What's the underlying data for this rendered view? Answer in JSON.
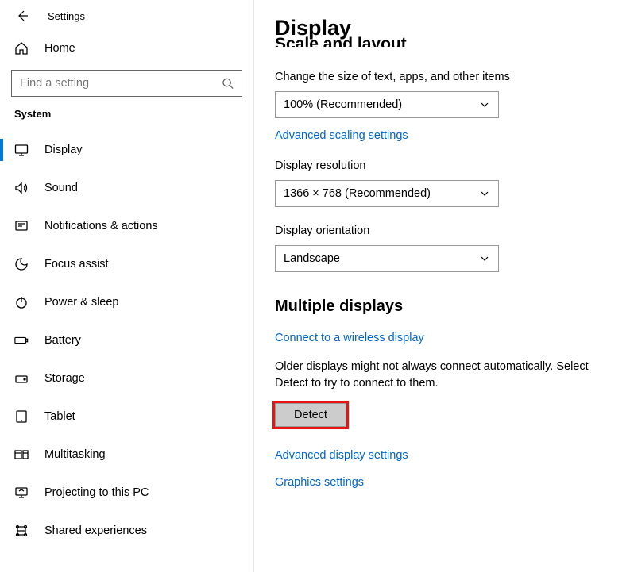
{
  "app_title": "Settings",
  "home_label": "Home",
  "search_placeholder": "Find a setting",
  "sidebar_section": "System",
  "nav": [
    {
      "label": "Display",
      "active": true
    },
    {
      "label": "Sound"
    },
    {
      "label": "Notifications & actions"
    },
    {
      "label": "Focus assist"
    },
    {
      "label": "Power & sleep"
    },
    {
      "label": "Battery"
    },
    {
      "label": "Storage"
    },
    {
      "label": "Tablet"
    },
    {
      "label": "Multitasking"
    },
    {
      "label": "Projecting to this PC"
    },
    {
      "label": "Shared experiences"
    }
  ],
  "page": {
    "title": "Display",
    "subhead_cut": "Scale and layout",
    "scale_label": "Change the size of text, apps, and other items",
    "scale_value": "100% (Recommended)",
    "adv_scaling_link": "Advanced scaling settings",
    "resolution_label": "Display resolution",
    "resolution_value": "1366 × 768 (Recommended)",
    "orientation_label": "Display orientation",
    "orientation_value": "Landscape",
    "multi_heading": "Multiple displays",
    "connect_link": "Connect to a wireless display",
    "detect_help": "Older displays might not always connect automatically. Select Detect to try to connect to them.",
    "detect_btn": "Detect",
    "adv_display_link": "Advanced display settings",
    "graphics_link": "Graphics settings"
  }
}
